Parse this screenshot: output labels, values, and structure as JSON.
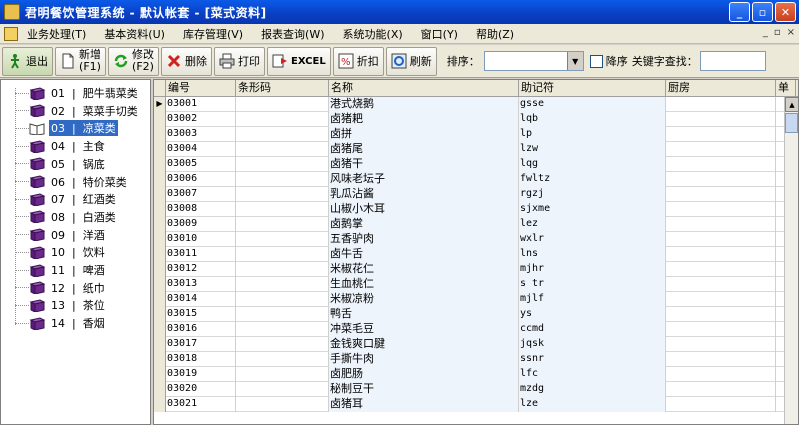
{
  "window": {
    "title": "君明餐饮管理系统 - 默认帐套 - [菜式资料]",
    "minimize": "_",
    "restore": "▫",
    "close": "✕"
  },
  "menu": {
    "items": [
      "业务处理(T)",
      "基本资料(U)",
      "库存管理(V)",
      "报表查询(W)",
      "系统功能(X)",
      "窗口(Y)",
      "帮助(Z)"
    ],
    "mdi_min": "_",
    "mdi_restore": "▫",
    "mdi_close": "×"
  },
  "toolbar": {
    "exit": "退出",
    "add": "新增",
    "add_key": "(F1)",
    "edit": "修改",
    "edit_key": "(F2)",
    "delete": "删除",
    "print": "打印",
    "excel": "EXCEL",
    "discount": "折扣",
    "refresh": "刷新",
    "sort_label": "排序：",
    "sort_value": "",
    "desc_label": "降序",
    "keyword_label": "关键字查找：",
    "keyword_value": ""
  },
  "tree": {
    "items": [
      {
        "code": "01",
        "name": "肥牛翡菜类"
      },
      {
        "code": "02",
        "name": "菜菜手切类"
      },
      {
        "code": "03",
        "name": "凉菜类"
      },
      {
        "code": "04",
        "name": "主食"
      },
      {
        "code": "05",
        "name": "锅底"
      },
      {
        "code": "06",
        "name": "特价菜类"
      },
      {
        "code": "07",
        "name": "红酒类"
      },
      {
        "code": "08",
        "name": "白酒类"
      },
      {
        "code": "09",
        "name": "洋酒"
      },
      {
        "code": "10",
        "name": "饮料"
      },
      {
        "code": "11",
        "name": "啤酒"
      },
      {
        "code": "12",
        "name": "纸巾"
      },
      {
        "code": "13",
        "name": "茶位"
      },
      {
        "code": "14",
        "name": "香烟"
      }
    ],
    "selected_index": 2
  },
  "grid": {
    "columns": [
      "编号",
      "条形码",
      "名称",
      "助记符",
      "厨房",
      "单"
    ],
    "current_row_marker": "▶",
    "rows": [
      {
        "code": "03001",
        "barcode": "",
        "name": "港式烧鹅",
        "abbr": "gsse",
        "kitchen": ""
      },
      {
        "code": "03002",
        "barcode": "",
        "name": "卤猪耙",
        "abbr": "lqb",
        "kitchen": ""
      },
      {
        "code": "03003",
        "barcode": "",
        "name": "卤拼",
        "abbr": "lp",
        "kitchen": ""
      },
      {
        "code": "03004",
        "barcode": "",
        "name": "卤猪尾",
        "abbr": "lzw",
        "kitchen": ""
      },
      {
        "code": "03005",
        "barcode": "",
        "name": "卤猪干",
        "abbr": "lqg",
        "kitchen": ""
      },
      {
        "code": "03006",
        "barcode": "",
        "name": "风味老坛子",
        "abbr": "fwltz",
        "kitchen": ""
      },
      {
        "code": "03007",
        "barcode": "",
        "name": "乳瓜沾酱",
        "abbr": "rgzj",
        "kitchen": ""
      },
      {
        "code": "03008",
        "barcode": "",
        "name": "山椒小木耳",
        "abbr": "sjxme",
        "kitchen": ""
      },
      {
        "code": "03009",
        "barcode": "",
        "name": "卤鹅掌",
        "abbr": "lez",
        "kitchen": ""
      },
      {
        "code": "03010",
        "barcode": "",
        "name": "五香驴肉",
        "abbr": "wxlr",
        "kitchen": ""
      },
      {
        "code": "03011",
        "barcode": "",
        "name": "卤牛舌",
        "abbr": "lns",
        "kitchen": ""
      },
      {
        "code": "03012",
        "barcode": "",
        "name": "米椒花仁",
        "abbr": "mjhr",
        "kitchen": ""
      },
      {
        "code": "03013",
        "barcode": "",
        "name": "生血桃仁",
        "abbr": "s tr",
        "kitchen": ""
      },
      {
        "code": "03014",
        "barcode": "",
        "name": "米椒凉粉",
        "abbr": "mjlf",
        "kitchen": ""
      },
      {
        "code": "03015",
        "barcode": "",
        "name": "鸭舌",
        "abbr": "ys",
        "kitchen": ""
      },
      {
        "code": "03016",
        "barcode": "",
        "name": "冲菜毛豆",
        "abbr": "ccmd",
        "kitchen": ""
      },
      {
        "code": "03017",
        "barcode": "",
        "name": "金钱爽口腱",
        "abbr": "jqsk",
        "kitchen": ""
      },
      {
        "code": "03018",
        "barcode": "",
        "name": "手撕牛肉",
        "abbr": "ssnr",
        "kitchen": ""
      },
      {
        "code": "03019",
        "barcode": "",
        "name": "卤肥肠",
        "abbr": "lfc",
        "kitchen": ""
      },
      {
        "code": "03020",
        "barcode": "",
        "name": "秘制豆干",
        "abbr": "mzdg",
        "kitchen": ""
      },
      {
        "code": "03021",
        "barcode": "",
        "name": "卤猪耳",
        "abbr": "lze",
        "kitchen": ""
      }
    ]
  },
  "colors": {
    "titlebar": "#0a46d0",
    "selection": "#316ac5",
    "book_icon": "#6a2a8a"
  }
}
